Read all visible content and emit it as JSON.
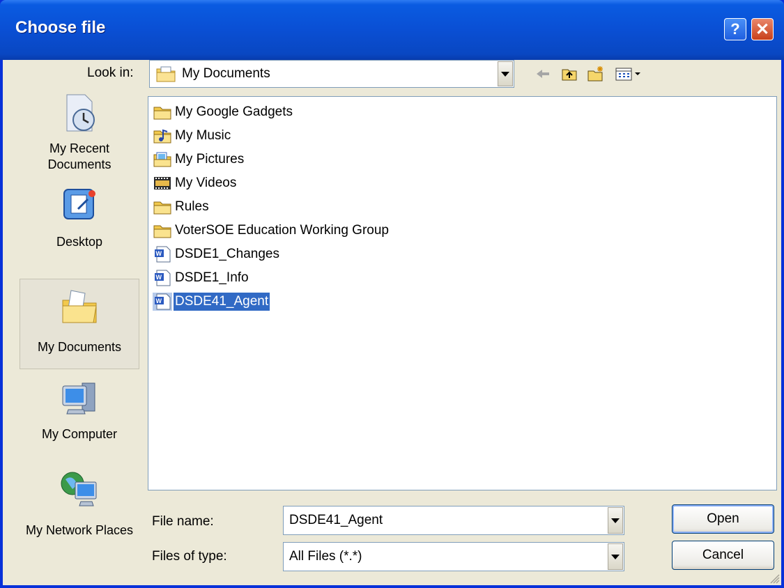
{
  "window": {
    "title": "Choose file"
  },
  "toolbar": {
    "look_in_label": "Look in:",
    "look_in_value": "My Documents",
    "icons": [
      "back-arrow-icon",
      "up-folder-icon",
      "new-folder-icon",
      "view-menu-icon"
    ]
  },
  "places": [
    {
      "label": "My Recent Documents",
      "icon": "recent-documents-icon"
    },
    {
      "label": "Desktop",
      "icon": "desktop-icon"
    },
    {
      "label": "My Documents",
      "icon": "my-documents-icon",
      "selected": true
    },
    {
      "label": "My Computer",
      "icon": "my-computer-icon"
    },
    {
      "label": "My Network Places",
      "icon": "network-places-icon"
    }
  ],
  "files": [
    {
      "name": "My Google Gadgets",
      "icon": "folder-icon"
    },
    {
      "name": "My Music",
      "icon": "music-folder-icon"
    },
    {
      "name": "My Pictures",
      "icon": "pictures-folder-icon"
    },
    {
      "name": "My Videos",
      "icon": "videos-folder-icon"
    },
    {
      "name": "Rules",
      "icon": "folder-icon"
    },
    {
      "name": "VoterSOE Education Working Group",
      "icon": "folder-icon"
    },
    {
      "name": "DSDE1_Changes",
      "icon": "word-document-icon"
    },
    {
      "name": "DSDE1_Info",
      "icon": "word-document-icon"
    },
    {
      "name": "DSDE41_Agent",
      "icon": "word-document-icon",
      "selected": true
    }
  ],
  "form": {
    "file_name_label": "File name:",
    "file_name_value": "DSDE41_Agent",
    "file_type_label": "Files of type:",
    "file_type_value": "All Files (*.*)"
  },
  "buttons": {
    "open": "Open",
    "cancel": "Cancel",
    "help": "?",
    "close": "✕"
  },
  "colors": {
    "titlebar": "#0A4FD4",
    "selection": "#316AC5",
    "face": "#ECE9D8"
  }
}
